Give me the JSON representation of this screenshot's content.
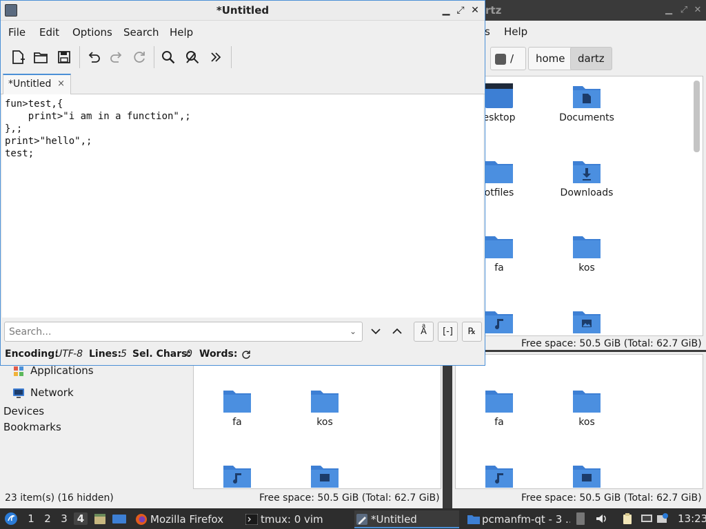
{
  "file_manager": {
    "title_partial": "rtz",
    "menu": {
      "tools_partial": "s",
      "help": "Help"
    },
    "path": {
      "root": "/",
      "home": "home",
      "current": "dartz"
    },
    "top_pane": {
      "items": [
        {
          "label": "esktop",
          "kind": "desktop"
        },
        {
          "label": "Documents",
          "kind": "documents"
        },
        {
          "label": "otfiles",
          "kind": "folder"
        },
        {
          "label": "Downloads",
          "kind": "downloads"
        },
        {
          "label": "fa",
          "kind": "folder"
        },
        {
          "label": "kos",
          "kind": "folder"
        },
        {
          "label": "",
          "kind": "music"
        },
        {
          "label": "",
          "kind": "pictures"
        }
      ],
      "free_space": "Free space: 50.5 GiB (Total: 62.7 GiB)"
    },
    "sidebar": {
      "items": [
        {
          "label": "Applications",
          "icon": "applications-icon"
        },
        {
          "label": "Network",
          "icon": "network-icon"
        }
      ],
      "headers": [
        "Devices",
        "Bookmarks"
      ]
    },
    "bottom_left_pane": {
      "items": [
        {
          "label": "fa",
          "kind": "folder"
        },
        {
          "label": "kos",
          "kind": "folder"
        },
        {
          "label": "",
          "kind": "music"
        },
        {
          "label": "",
          "kind": "pictures"
        }
      ]
    },
    "bottom_right_pane": {
      "items": [
        {
          "label": "fa",
          "kind": "folder"
        },
        {
          "label": "kos",
          "kind": "folder"
        },
        {
          "label": "",
          "kind": "music"
        },
        {
          "label": "",
          "kind": "pictures"
        }
      ],
      "free_space": "Free space: 50.5 GiB (Total: 62.7 GiB)"
    },
    "status": {
      "item_count": "23 item(s) (16 hidden)",
      "free_space_left": "Free space: 50.5 GiB (Total: 62.7 GiB)",
      "free_space_right": "Free space: 50.5 GiB (Total: 62.7 GiB)"
    }
  },
  "editor": {
    "title": "*Untitled",
    "menu": [
      "File",
      "Edit",
      "Options",
      "Search",
      "Help"
    ],
    "toolbar": [
      "new-file-icon",
      "open-folder-icon",
      "save-icon",
      "undo-icon",
      "redo-icon",
      "reload-icon",
      "find-icon",
      "replace-icon",
      "more-icon"
    ],
    "tab": {
      "label": "*Untitled",
      "close": "×"
    },
    "text": "fun>test,{\n    print>\"i am in a function\",;\n},;\nprint>\"hello\",;\ntest;",
    "search": {
      "placeholder": "Search..."
    },
    "status": {
      "encoding_label": "Encoding:",
      "encoding": "UTF-8",
      "lines_label": "Lines:",
      "lines": "5",
      "sel_label": "Sel. Chars:",
      "sel": "0",
      "words_label": "Words:"
    }
  },
  "taskbar": {
    "workspaces": [
      "1",
      "2",
      "3",
      "4"
    ],
    "current_workspace": "4",
    "tasks": [
      {
        "label": "Mozilla Firefox",
        "icon": "firefox-icon"
      },
      {
        "label": "tmux: 0 vim",
        "icon": "terminal-icon"
      },
      {
        "label": "*Untitled",
        "icon": "text-editor-icon"
      },
      {
        "label": "pcmanfm-qt - 3 ...",
        "icon": "file-manager-icon"
      }
    ],
    "clock": "13:23"
  },
  "colors": {
    "accent": "#4a8fd6",
    "folder": "#3d7fd4",
    "taskbar": "#2d2d2d"
  }
}
